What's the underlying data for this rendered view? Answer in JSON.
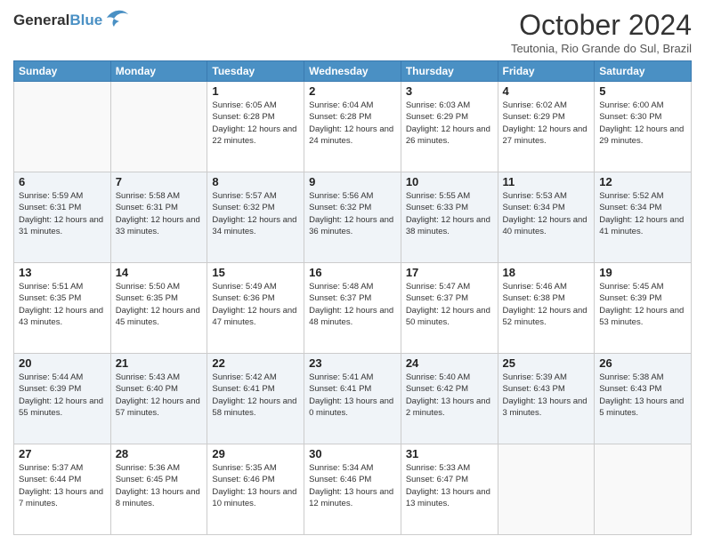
{
  "header": {
    "logo_general": "General",
    "logo_blue": "Blue",
    "title": "October 2024",
    "subtitle": "Teutonia, Rio Grande do Sul, Brazil"
  },
  "weekdays": [
    "Sunday",
    "Monday",
    "Tuesday",
    "Wednesday",
    "Thursday",
    "Friday",
    "Saturday"
  ],
  "weeks": [
    [
      {
        "day": "",
        "sunrise": "",
        "sunset": "",
        "daylight": ""
      },
      {
        "day": "",
        "sunrise": "",
        "sunset": "",
        "daylight": ""
      },
      {
        "day": "1",
        "sunrise": "Sunrise: 6:05 AM",
        "sunset": "Sunset: 6:28 PM",
        "daylight": "Daylight: 12 hours and 22 minutes."
      },
      {
        "day": "2",
        "sunrise": "Sunrise: 6:04 AM",
        "sunset": "Sunset: 6:28 PM",
        "daylight": "Daylight: 12 hours and 24 minutes."
      },
      {
        "day": "3",
        "sunrise": "Sunrise: 6:03 AM",
        "sunset": "Sunset: 6:29 PM",
        "daylight": "Daylight: 12 hours and 26 minutes."
      },
      {
        "day": "4",
        "sunrise": "Sunrise: 6:02 AM",
        "sunset": "Sunset: 6:29 PM",
        "daylight": "Daylight: 12 hours and 27 minutes."
      },
      {
        "day": "5",
        "sunrise": "Sunrise: 6:00 AM",
        "sunset": "Sunset: 6:30 PM",
        "daylight": "Daylight: 12 hours and 29 minutes."
      }
    ],
    [
      {
        "day": "6",
        "sunrise": "Sunrise: 5:59 AM",
        "sunset": "Sunset: 6:31 PM",
        "daylight": "Daylight: 12 hours and 31 minutes."
      },
      {
        "day": "7",
        "sunrise": "Sunrise: 5:58 AM",
        "sunset": "Sunset: 6:31 PM",
        "daylight": "Daylight: 12 hours and 33 minutes."
      },
      {
        "day": "8",
        "sunrise": "Sunrise: 5:57 AM",
        "sunset": "Sunset: 6:32 PM",
        "daylight": "Daylight: 12 hours and 34 minutes."
      },
      {
        "day": "9",
        "sunrise": "Sunrise: 5:56 AM",
        "sunset": "Sunset: 6:32 PM",
        "daylight": "Daylight: 12 hours and 36 minutes."
      },
      {
        "day": "10",
        "sunrise": "Sunrise: 5:55 AM",
        "sunset": "Sunset: 6:33 PM",
        "daylight": "Daylight: 12 hours and 38 minutes."
      },
      {
        "day": "11",
        "sunrise": "Sunrise: 5:53 AM",
        "sunset": "Sunset: 6:34 PM",
        "daylight": "Daylight: 12 hours and 40 minutes."
      },
      {
        "day": "12",
        "sunrise": "Sunrise: 5:52 AM",
        "sunset": "Sunset: 6:34 PM",
        "daylight": "Daylight: 12 hours and 41 minutes."
      }
    ],
    [
      {
        "day": "13",
        "sunrise": "Sunrise: 5:51 AM",
        "sunset": "Sunset: 6:35 PM",
        "daylight": "Daylight: 12 hours and 43 minutes."
      },
      {
        "day": "14",
        "sunrise": "Sunrise: 5:50 AM",
        "sunset": "Sunset: 6:35 PM",
        "daylight": "Daylight: 12 hours and 45 minutes."
      },
      {
        "day": "15",
        "sunrise": "Sunrise: 5:49 AM",
        "sunset": "Sunset: 6:36 PM",
        "daylight": "Daylight: 12 hours and 47 minutes."
      },
      {
        "day": "16",
        "sunrise": "Sunrise: 5:48 AM",
        "sunset": "Sunset: 6:37 PM",
        "daylight": "Daylight: 12 hours and 48 minutes."
      },
      {
        "day": "17",
        "sunrise": "Sunrise: 5:47 AM",
        "sunset": "Sunset: 6:37 PM",
        "daylight": "Daylight: 12 hours and 50 minutes."
      },
      {
        "day": "18",
        "sunrise": "Sunrise: 5:46 AM",
        "sunset": "Sunset: 6:38 PM",
        "daylight": "Daylight: 12 hours and 52 minutes."
      },
      {
        "day": "19",
        "sunrise": "Sunrise: 5:45 AM",
        "sunset": "Sunset: 6:39 PM",
        "daylight": "Daylight: 12 hours and 53 minutes."
      }
    ],
    [
      {
        "day": "20",
        "sunrise": "Sunrise: 5:44 AM",
        "sunset": "Sunset: 6:39 PM",
        "daylight": "Daylight: 12 hours and 55 minutes."
      },
      {
        "day": "21",
        "sunrise": "Sunrise: 5:43 AM",
        "sunset": "Sunset: 6:40 PM",
        "daylight": "Daylight: 12 hours and 57 minutes."
      },
      {
        "day": "22",
        "sunrise": "Sunrise: 5:42 AM",
        "sunset": "Sunset: 6:41 PM",
        "daylight": "Daylight: 12 hours and 58 minutes."
      },
      {
        "day": "23",
        "sunrise": "Sunrise: 5:41 AM",
        "sunset": "Sunset: 6:41 PM",
        "daylight": "Daylight: 13 hours and 0 minutes."
      },
      {
        "day": "24",
        "sunrise": "Sunrise: 5:40 AM",
        "sunset": "Sunset: 6:42 PM",
        "daylight": "Daylight: 13 hours and 2 minutes."
      },
      {
        "day": "25",
        "sunrise": "Sunrise: 5:39 AM",
        "sunset": "Sunset: 6:43 PM",
        "daylight": "Daylight: 13 hours and 3 minutes."
      },
      {
        "day": "26",
        "sunrise": "Sunrise: 5:38 AM",
        "sunset": "Sunset: 6:43 PM",
        "daylight": "Daylight: 13 hours and 5 minutes."
      }
    ],
    [
      {
        "day": "27",
        "sunrise": "Sunrise: 5:37 AM",
        "sunset": "Sunset: 6:44 PM",
        "daylight": "Daylight: 13 hours and 7 minutes."
      },
      {
        "day": "28",
        "sunrise": "Sunrise: 5:36 AM",
        "sunset": "Sunset: 6:45 PM",
        "daylight": "Daylight: 13 hours and 8 minutes."
      },
      {
        "day": "29",
        "sunrise": "Sunrise: 5:35 AM",
        "sunset": "Sunset: 6:46 PM",
        "daylight": "Daylight: 13 hours and 10 minutes."
      },
      {
        "day": "30",
        "sunrise": "Sunrise: 5:34 AM",
        "sunset": "Sunset: 6:46 PM",
        "daylight": "Daylight: 13 hours and 12 minutes."
      },
      {
        "day": "31",
        "sunrise": "Sunrise: 5:33 AM",
        "sunset": "Sunset: 6:47 PM",
        "daylight": "Daylight: 13 hours and 13 minutes."
      },
      {
        "day": "",
        "sunrise": "",
        "sunset": "",
        "daylight": ""
      },
      {
        "day": "",
        "sunrise": "",
        "sunset": "",
        "daylight": ""
      }
    ]
  ]
}
